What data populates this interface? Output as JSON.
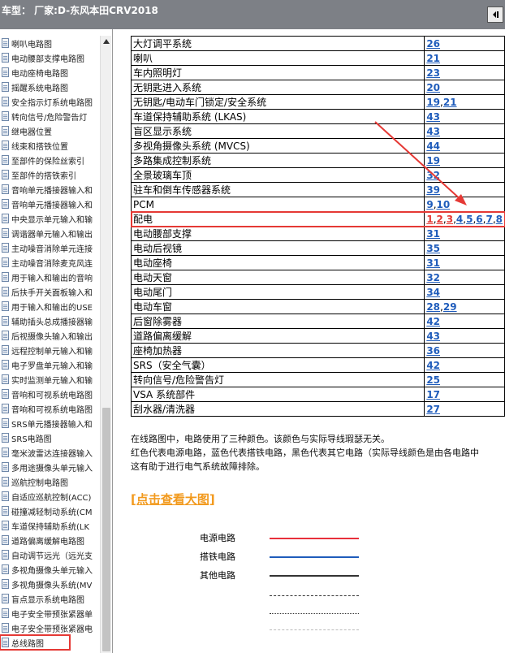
{
  "header": {
    "title": "车型：  厂家:D-东风本田CRV2018",
    "button_icon": "panel-toggle-icon"
  },
  "sidebar": {
    "items": [
      {
        "label": "喇叭电路图"
      },
      {
        "label": "电动腰部支撑电路图"
      },
      {
        "label": "电动座椅电路图"
      },
      {
        "label": "摇醒系统电路图"
      },
      {
        "label": "安全指示灯系统电路图"
      },
      {
        "label": "转向信号/危险警告灯"
      },
      {
        "label": "继电器位置"
      },
      {
        "label": "线束和搭铁位置"
      },
      {
        "label": "至部件的保险丝索引"
      },
      {
        "label": "至部件的搭铁索引"
      },
      {
        "label": "音响单元播接器输入和"
      },
      {
        "label": "音响单元播接器输入和"
      },
      {
        "label": "中央显示单元输入和输"
      },
      {
        "label": "调谐器单元输入和输出"
      },
      {
        "label": "主动噪音消除单元连接"
      },
      {
        "label": "主动噪音消除麦克风连"
      },
      {
        "label": "用于输入和输出的音响"
      },
      {
        "label": "后扶手开关面板输入和"
      },
      {
        "label": "用于输入和输出的USE"
      },
      {
        "label": "辅助插头总成播接器输"
      },
      {
        "label": "后视摄像头输入和输出"
      },
      {
        "label": "远程控制单元输入和输"
      },
      {
        "label": "电子罗盘单元输入和输"
      },
      {
        "label": "实时监测单元输入和输"
      },
      {
        "label": "音响和可视系统电路图"
      },
      {
        "label": "音响和可视系统电路图"
      },
      {
        "label": "SRS单元播接器输入和"
      },
      {
        "label": "SRS电路图"
      },
      {
        "label": "毫米波雷达连接器输入"
      },
      {
        "label": "多用途摄像头单元输入"
      },
      {
        "label": "巡航控制电路图"
      },
      {
        "label": "自适应巡航控制(ACC)"
      },
      {
        "label": "碰撞减轻制动系统(CM"
      },
      {
        "label": "车道保持辅助系统(LK"
      },
      {
        "label": "道路偏离缓解电路图"
      },
      {
        "label": "自动调节远光（远光支"
      },
      {
        "label": "多视角摄像头单元输入"
      },
      {
        "label": "多视角摄像头系统(MV"
      },
      {
        "label": "盲点显示系统电路图"
      },
      {
        "label": "电子安全带预张紧器单"
      },
      {
        "label": "电子安全带预张紧器电"
      },
      {
        "label": "总线路图"
      }
    ]
  },
  "table": {
    "rows": [
      {
        "name": "大灯调平系统",
        "pages": [
          "26"
        ]
      },
      {
        "name": "喇叭",
        "pages": [
          "21"
        ]
      },
      {
        "name": "车内照明灯",
        "pages": [
          "23"
        ]
      },
      {
        "name": "无钥匙进入系统",
        "pages": [
          "20"
        ]
      },
      {
        "name": "无钥匙/电动车门锁定/安全系统",
        "pages": [
          "19",
          "21"
        ]
      },
      {
        "name": "车道保持辅助系统 (LKAS)",
        "pages": [
          "43"
        ]
      },
      {
        "name": "盲区显示系统",
        "pages": [
          "43"
        ]
      },
      {
        "name": "多视角摄像头系统 (MVCS)",
        "pages": [
          "44"
        ]
      },
      {
        "name": "多路集成控制系统",
        "pages": [
          "19"
        ]
      },
      {
        "name": "全景玻璃车顶",
        "pages": [
          "32"
        ]
      },
      {
        "name": "驻车和倒车传感器系统",
        "pages": [
          "39"
        ]
      },
      {
        "name": "PCM",
        "pages": [
          "9",
          "10"
        ]
      },
      {
        "name": "配电",
        "pages": [
          "1",
          "2",
          "3",
          "4",
          "5",
          "6",
          "7",
          "8"
        ]
      },
      {
        "name": "电动腰部支撑",
        "pages": [
          "31"
        ]
      },
      {
        "name": "电动后视镜",
        "pages": [
          "35"
        ]
      },
      {
        "name": "电动座椅",
        "pages": [
          "31"
        ]
      },
      {
        "name": "电动天窗",
        "pages": [
          "32"
        ]
      },
      {
        "name": "电动尾门",
        "pages": [
          "34"
        ]
      },
      {
        "name": "电动车窗",
        "pages": [
          "28",
          "29"
        ]
      },
      {
        "name": "后窗除雾器",
        "pages": [
          "42"
        ]
      },
      {
        "name": "道路偏离缓解",
        "pages": [
          "43"
        ]
      },
      {
        "name": "座椅加热器",
        "pages": [
          "36"
        ]
      },
      {
        "name": "SRS（安全气囊）",
        "pages": [
          "42"
        ]
      },
      {
        "name": "转向信号/危险警告灯",
        "pages": [
          "25"
        ]
      },
      {
        "name": "VSA 系统部件",
        "pages": [
          "17"
        ]
      },
      {
        "name": "刮水器/清洗器",
        "pages": [
          "27"
        ]
      }
    ]
  },
  "description": {
    "line1": "在线路图中，电路使用了三种颜色。该颜色与实际导线瑕瑟无关。",
    "line2": "红色代表电源电路，蓝色代表搭铁电路，黑色代表其它电路（实际导线颜色是由各电路中",
    "line3": "这有助于进行电气系统故障排除。"
  },
  "view_large_link": "[点击查看大图]",
  "legend": {
    "items": [
      {
        "label": "电源电路",
        "color": "#e8303b",
        "style": "solid"
      },
      {
        "label": "搭铁电路",
        "color": "#1f5cbb",
        "style": "solid"
      },
      {
        "label": "其他电路",
        "color": "#333333",
        "style": "solid"
      },
      {
        "label": "",
        "color": "#333333",
        "style": "dashed"
      },
      {
        "label": "",
        "color": "#333333",
        "style": "dotted"
      },
      {
        "label": "",
        "color": "#bbbbbb",
        "style": "dashed"
      }
    ]
  },
  "colors": {
    "highlight": "#e53935",
    "link": "#1f5cbb",
    "link_large": "#f29a1e",
    "topbar": "#7d8086"
  }
}
